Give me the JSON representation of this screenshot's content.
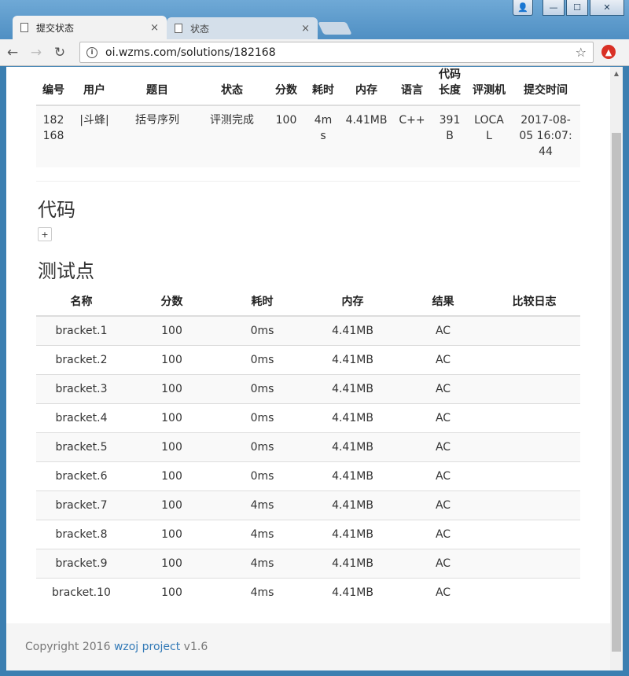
{
  "browser": {
    "tabs": [
      {
        "label": "提交状态",
        "close": "×"
      },
      {
        "label": "状态",
        "close": "×"
      }
    ],
    "url": "oi.wzms.com/solutions/182168",
    "nav": {
      "back": "←",
      "forward": "→",
      "reload": "↻"
    },
    "star": "☆",
    "window": {
      "minimize": "—",
      "maximize": "☐",
      "close": "✕",
      "user": "👤"
    }
  },
  "submission": {
    "headers": [
      "编号",
      "用户",
      "题目",
      "状态",
      "分数",
      "耗时",
      "内存",
      "语言",
      "代码长度",
      "评测机",
      "提交时间"
    ],
    "row": {
      "id": "182168",
      "user": "|斗蜂|",
      "problem": "括号序列",
      "status": "评测完成",
      "score": "100",
      "time": "4ms",
      "memory": "4.41MB",
      "language": "C++",
      "code_length": "391B",
      "judger": "LOCAL",
      "submit_time": "2017-08-05 16:07:44"
    }
  },
  "code_section": {
    "title": "代码",
    "toggle": "+"
  },
  "tests_section": {
    "title": "测试点",
    "headers": [
      "名称",
      "分数",
      "耗时",
      "内存",
      "结果",
      "比较日志"
    ],
    "rows": [
      {
        "name": "bracket.1",
        "score": "100",
        "time": "0ms",
        "memory": "4.41MB",
        "result": "AC",
        "log": ""
      },
      {
        "name": "bracket.2",
        "score": "100",
        "time": "0ms",
        "memory": "4.41MB",
        "result": "AC",
        "log": ""
      },
      {
        "name": "bracket.3",
        "score": "100",
        "time": "0ms",
        "memory": "4.41MB",
        "result": "AC",
        "log": ""
      },
      {
        "name": "bracket.4",
        "score": "100",
        "time": "0ms",
        "memory": "4.41MB",
        "result": "AC",
        "log": ""
      },
      {
        "name": "bracket.5",
        "score": "100",
        "time": "0ms",
        "memory": "4.41MB",
        "result": "AC",
        "log": ""
      },
      {
        "name": "bracket.6",
        "score": "100",
        "time": "0ms",
        "memory": "4.41MB",
        "result": "AC",
        "log": ""
      },
      {
        "name": "bracket.7",
        "score": "100",
        "time": "4ms",
        "memory": "4.41MB",
        "result": "AC",
        "log": ""
      },
      {
        "name": "bracket.8",
        "score": "100",
        "time": "4ms",
        "memory": "4.41MB",
        "result": "AC",
        "log": ""
      },
      {
        "name": "bracket.9",
        "score": "100",
        "time": "4ms",
        "memory": "4.41MB",
        "result": "AC",
        "log": ""
      },
      {
        "name": "bracket.10",
        "score": "100",
        "time": "4ms",
        "memory": "4.41MB",
        "result": "AC",
        "log": ""
      }
    ]
  },
  "footer": {
    "prefix": "Copyright 2016 ",
    "link": "wzoj project",
    "suffix": " v1.6"
  },
  "colors": {
    "link": "#337ab7",
    "frame": "#3c7fb1"
  }
}
